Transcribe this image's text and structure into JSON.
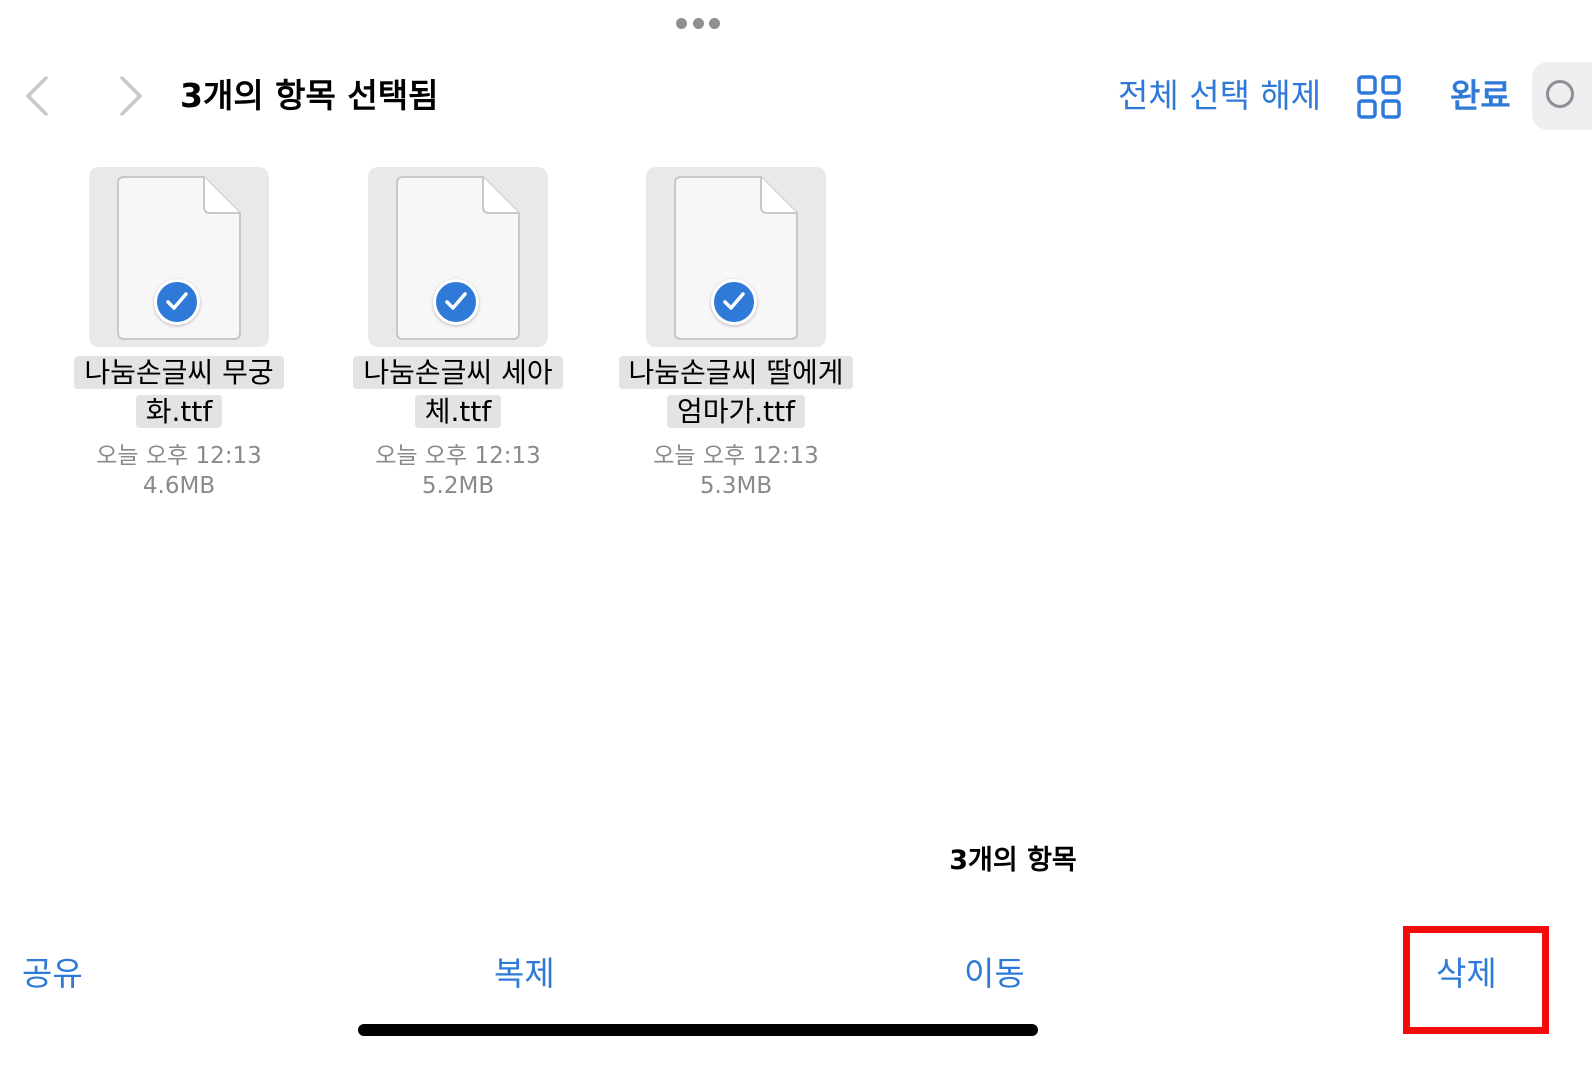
{
  "nav": {
    "title": "3개의 항목 선택됨",
    "deselect_all": "전체 선택 해제",
    "done": "완료"
  },
  "files": [
    {
      "name_line1": "나눔손글씨 무궁",
      "name_line2": "화.ttf",
      "date": "오늘 오후 12:13",
      "size": "4.6MB",
      "selected": true
    },
    {
      "name_line1": "나눔손글씨 세아",
      "name_line2": "체.ttf",
      "date": "오늘 오후 12:13",
      "size": "5.2MB",
      "selected": true
    },
    {
      "name_line1": "나눔손글씨 딸에게",
      "name_line2": "엄마가.ttf",
      "date": "오늘 오후 12:13",
      "size": "5.3MB",
      "selected": true
    }
  ],
  "footer": {
    "count": "3개의 항목"
  },
  "toolbar": {
    "share": "공유",
    "duplicate": "복제",
    "move": "이동",
    "delete": "삭제"
  },
  "colors": {
    "accent": "#2f7ad8",
    "highlight": "#f20c0c",
    "thumb_bg": "#e9e9eb"
  },
  "icons": {
    "back": "chevron-left-icon",
    "forward": "chevron-right-icon",
    "view": "grid-view-icon",
    "search": "search-icon",
    "check": "checkmark-circle-icon",
    "file": "document-icon"
  }
}
